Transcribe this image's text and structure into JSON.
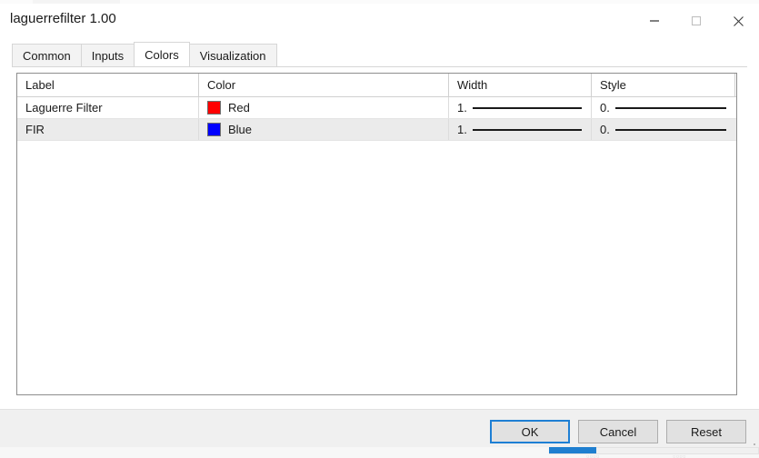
{
  "window": {
    "title": "laguerrefilter 1.00",
    "controls": [
      {
        "name": "minimize",
        "glyph": "minimize-icon"
      },
      {
        "name": "maximize",
        "glyph": "maximize-icon"
      },
      {
        "name": "close",
        "glyph": "close-icon"
      }
    ]
  },
  "tabs": [
    {
      "label": "Common",
      "active": false
    },
    {
      "label": "Inputs",
      "active": false
    },
    {
      "label": "Colors",
      "active": true
    },
    {
      "label": "Visualization",
      "active": false
    }
  ],
  "grid": {
    "columns": [
      "Label",
      "Color",
      "Width",
      "Style"
    ],
    "rows": [
      {
        "label": "Laguerre Filter",
        "color_name": "Red",
        "color_hex": "#FF0000",
        "width_value": "1.",
        "style_value": "0."
      },
      {
        "label": "FIR",
        "color_name": "Blue",
        "color_hex": "#0000FF",
        "width_value": "1.",
        "style_value": "0."
      }
    ]
  },
  "footer": {
    "ok_label": "OK",
    "cancel_label": "Cancel",
    "reset_label": "Reset"
  }
}
